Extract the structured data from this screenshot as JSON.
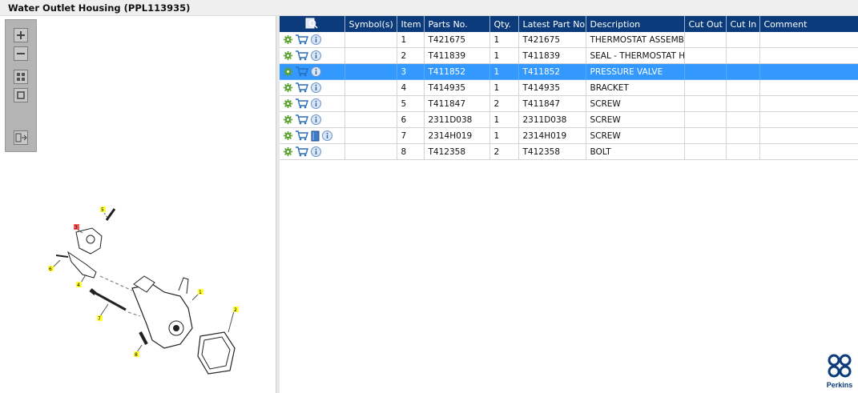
{
  "window": {
    "title": "Water Outlet Housing (PPL113935)"
  },
  "grid": {
    "columns": [
      "Symbol(s)",
      "Item",
      "Parts No.",
      "Qty.",
      "Latest Part No.",
      "Description",
      "Cut Out",
      "Cut In",
      "Comment"
    ],
    "rows": [
      {
        "item": "1",
        "parts_no": "T421675",
        "qty": "1",
        "latest": "T421675",
        "desc": "THERMOSTAT ASSEMBLY"
      },
      {
        "item": "2",
        "parts_no": "T411839",
        "qty": "1",
        "latest": "T411839",
        "desc": "SEAL - THERMOSTAT HOUSING"
      },
      {
        "item": "3",
        "parts_no": "T411852",
        "qty": "1",
        "latest": "T411852",
        "desc": "PRESSURE VALVE"
      },
      {
        "item": "4",
        "parts_no": "T414935",
        "qty": "1",
        "latest": "T414935",
        "desc": "BRACKET"
      },
      {
        "item": "5",
        "parts_no": "T411847",
        "qty": "2",
        "latest": "T411847",
        "desc": "SCREW"
      },
      {
        "item": "6",
        "parts_no": "2311D038",
        "qty": "1",
        "latest": "2311D038",
        "desc": "SCREW"
      },
      {
        "item": "7",
        "parts_no": "2314H019",
        "qty": "1",
        "latest": "2314H019",
        "desc": "SCREW"
      },
      {
        "item": "8",
        "parts_no": "T412358",
        "qty": "2",
        "latest": "T412358",
        "desc": "BOLT"
      }
    ],
    "selected_item": "3"
  },
  "diagram": {
    "callouts": [
      "1",
      "2",
      "3",
      "4",
      "5",
      "6",
      "7",
      "8"
    ],
    "highlighted": "3"
  },
  "brand": {
    "name": "Perkins",
    "color": "#0b3b7a"
  },
  "colors": {
    "header": "#0b3b7a",
    "selection": "#3399ff",
    "callout": "#ffff33",
    "callout_highlight": "#ff4444"
  },
  "icons": {
    "settings": "gear-icon",
    "cart": "shopping-cart-icon",
    "info": "info-icon",
    "book": "book-icon",
    "search": "search-doc-icon"
  }
}
